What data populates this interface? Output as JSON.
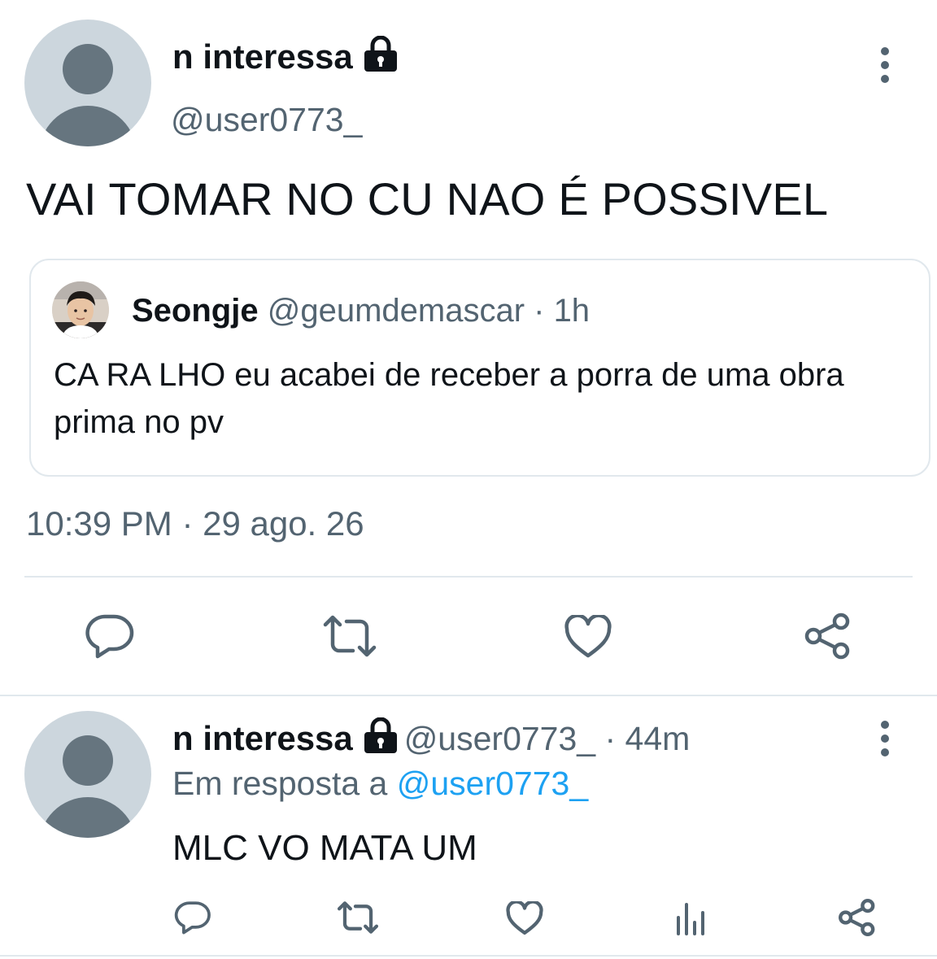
{
  "tweet": {
    "author_name": "n interessa",
    "author_handle": "@user0773_",
    "text": "VAI TOMAR NO CU NAO É POSSIVEL",
    "timestamp": "10:39 PM · 29 ago. 26",
    "quoted": {
      "author_name": "Seongje",
      "author_handle": "@geumdemascar",
      "separator": " · ",
      "time": "1h",
      "text": "CA RA LHO eu acabei de receber a porra de uma obra prima no pv"
    }
  },
  "reply": {
    "author_name": "n interessa",
    "author_handle": "@user0773_",
    "separator": " · ",
    "time": "44m",
    "in_reply_prefix": "Em resposta a ",
    "in_reply_mention": "@user0773_",
    "text": "MLC VO MATA UM"
  },
  "icons": {
    "lock": "lock-icon",
    "more": "more-vertical-icon",
    "reply": "reply-icon",
    "retweet": "retweet-icon",
    "like": "heart-icon",
    "share": "share-icon",
    "analytics": "analytics-icon"
  },
  "colors": {
    "text": "#0f1419",
    "secondary": "#536471",
    "mention": "#1da1f2",
    "border": "#e1e8ed",
    "avatar_bg": "#ccd6dd",
    "avatar_fg": "#66757f"
  }
}
